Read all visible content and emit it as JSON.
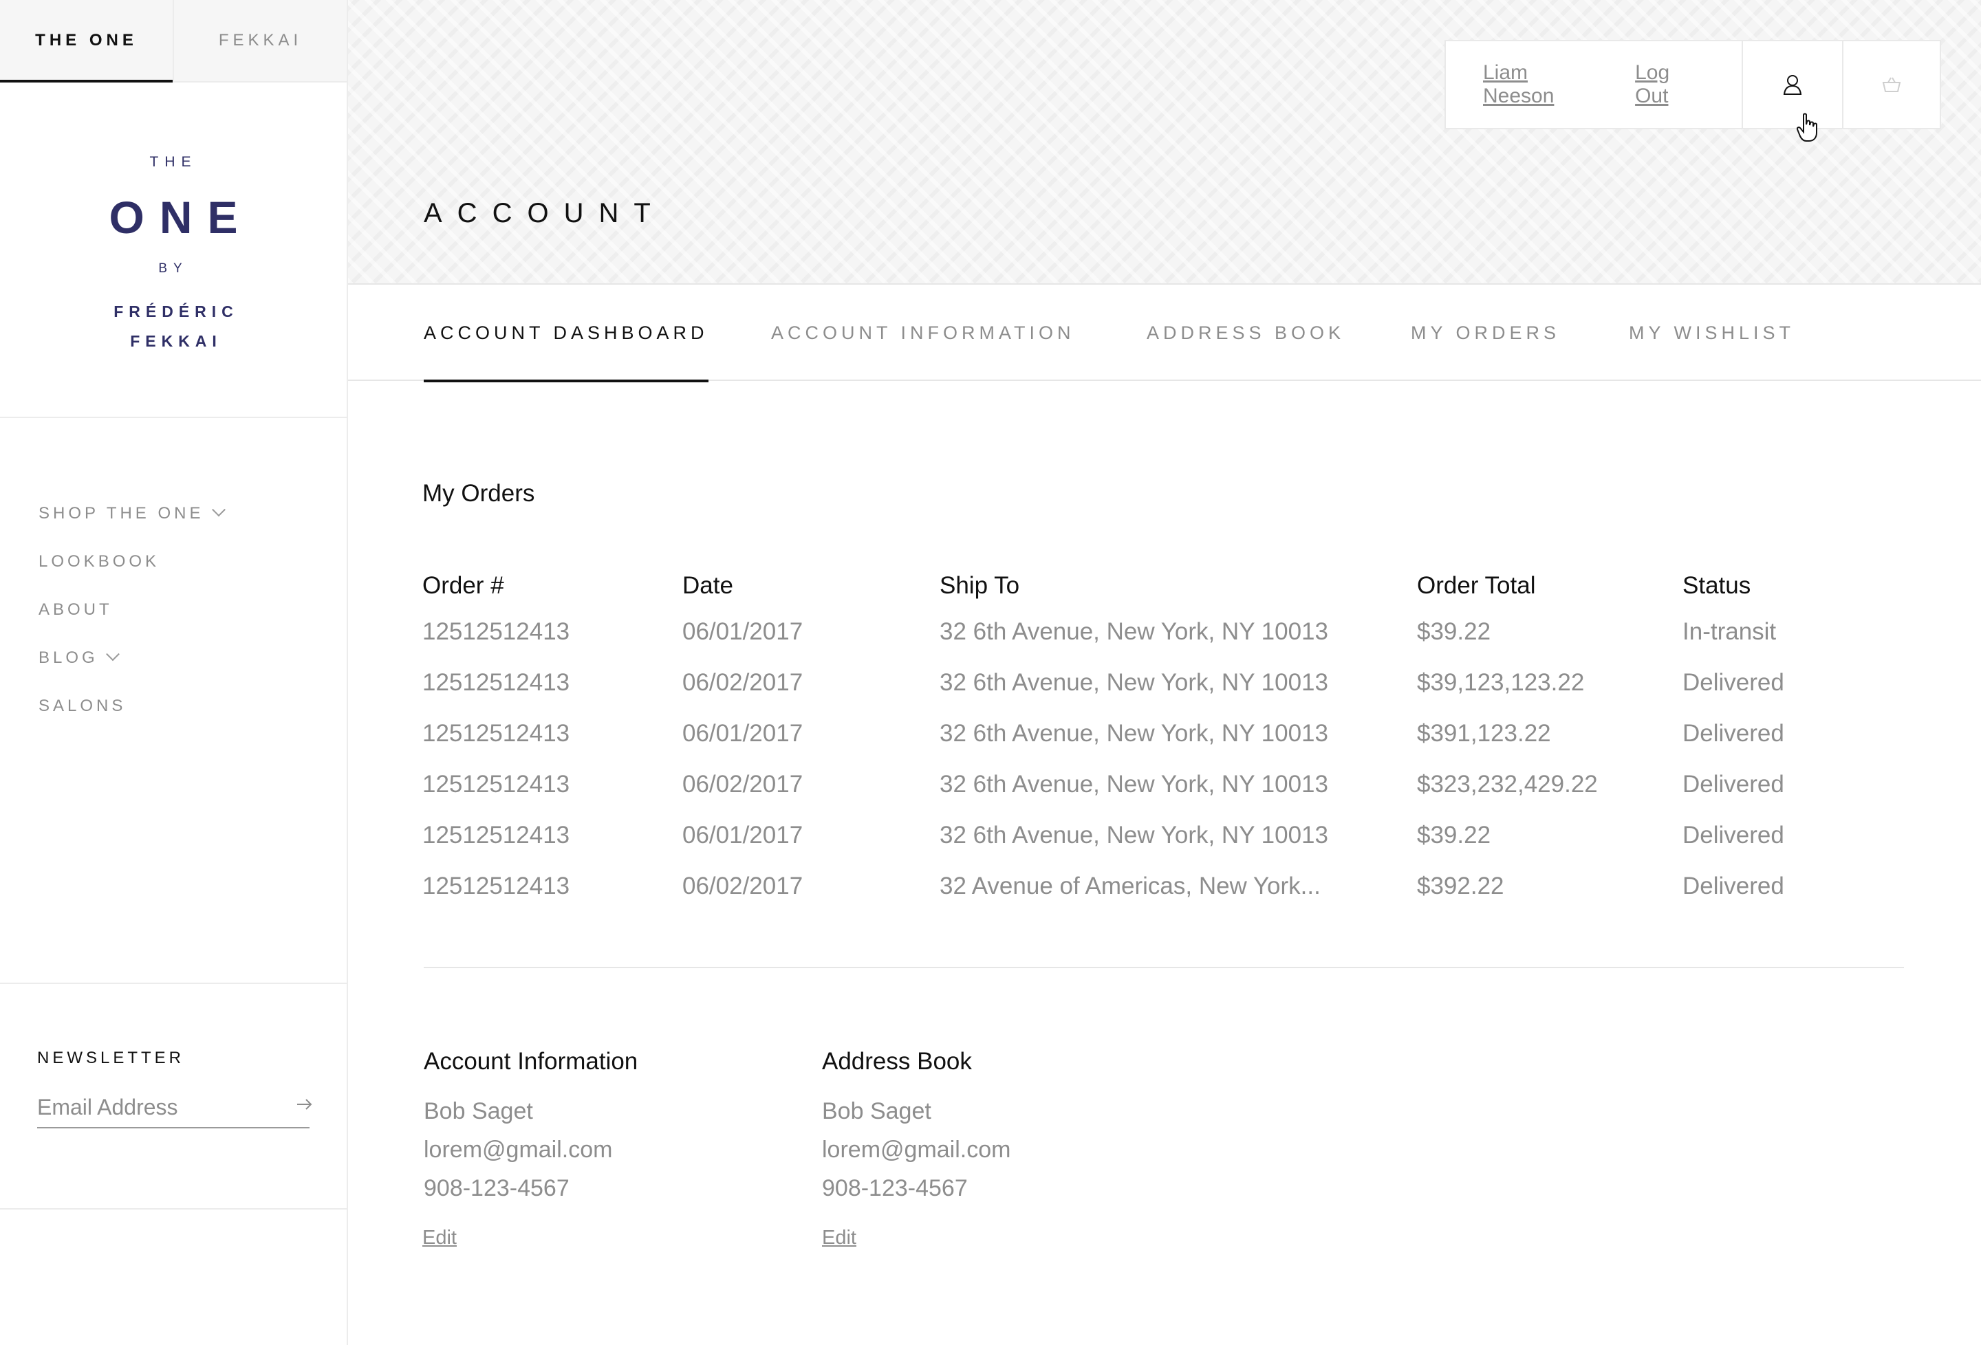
{
  "brand_tabs": [
    "THE ONE",
    "FEKKAI"
  ],
  "logo": {
    "line1": "THE",
    "line2": "ONE",
    "line3": "BY",
    "line4": "FRÉDÉRIC",
    "line5": "FEKKAI"
  },
  "sidebar_nav": [
    {
      "label": "SHOP THE ONE",
      "has_dropdown": true
    },
    {
      "label": "LOOKBOOK",
      "has_dropdown": false
    },
    {
      "label": "ABOUT",
      "has_dropdown": false
    },
    {
      "label": "BLOG",
      "has_dropdown": true
    },
    {
      "label": "SALONS",
      "has_dropdown": false
    }
  ],
  "newsletter": {
    "title": "NEWSLETTER",
    "placeholder": "Email Address"
  },
  "user": {
    "name": "Liam Neeson",
    "logout": "Log Out"
  },
  "icons": {
    "account": "user-icon",
    "cart": "basket-icon",
    "cursor": "hand-pointer-icon",
    "submit": "arrow-right-icon"
  },
  "page_title": "ACCOUNT",
  "tabs": [
    "ACCOUNT DASHBOARD",
    "ACCOUNT INFORMATION",
    "ADDRESS BOOK",
    "MY ORDERS",
    "MY WISHLIST"
  ],
  "active_tab": "ACCOUNT DASHBOARD",
  "orders": {
    "title": "My Orders",
    "columns": [
      "Order #",
      "Date",
      "Ship To",
      "Order Total",
      "Status"
    ],
    "rows": [
      [
        "12512512413",
        "06/01/2017",
        "32 6th Avenue, New York, NY 10013",
        "$39.22",
        "In-transit"
      ],
      [
        "12512512413",
        "06/02/2017",
        "32 6th Avenue, New York, NY 10013",
        "$39,123,123.22",
        "Delivered"
      ],
      [
        "12512512413",
        "06/01/2017",
        "32 6th Avenue, New York, NY 10013",
        "$391,123.22",
        "Delivered"
      ],
      [
        "12512512413",
        "06/02/2017",
        "32 6th Avenue, New York, NY 10013",
        "$323,232,429.22",
        "Delivered"
      ],
      [
        "12512512413",
        "06/01/2017",
        "32 6th Avenue, New York, NY 10013",
        "$39.22",
        "Delivered"
      ],
      [
        "12512512413",
        "06/02/2017",
        "32 Avenue of Americas, New York...",
        "$392.22",
        "Delivered"
      ]
    ]
  },
  "account_info": {
    "title": "Account Information",
    "name": "Bob Saget",
    "email": "lorem@gmail.com",
    "phone": "908-123-4567",
    "edit": "Edit"
  },
  "address_book": {
    "title": "Address Book",
    "name": "Bob Saget",
    "email": "lorem@gmail.com",
    "phone": "908-123-4567",
    "edit": "Edit"
  },
  "colors": {
    "brand": "#2f2f66",
    "muted_text": "#8d8d8d",
    "text": "#111111",
    "border": "#e6e6e6"
  }
}
